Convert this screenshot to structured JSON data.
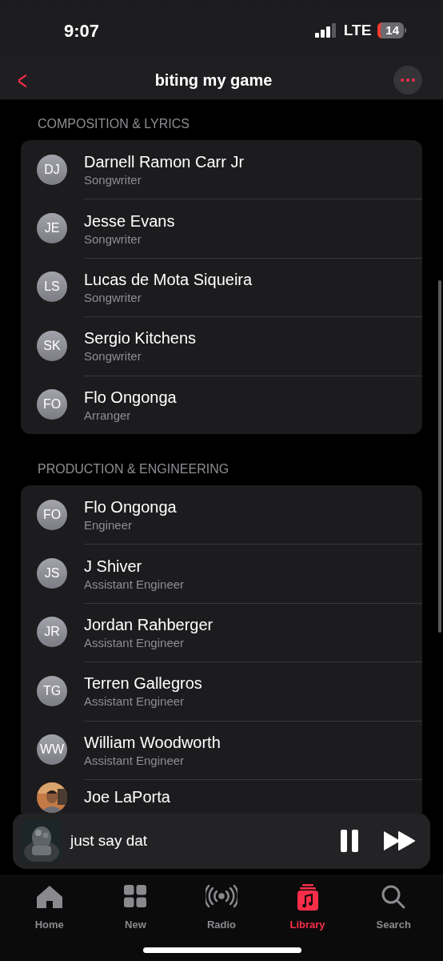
{
  "status_bar": {
    "time": "9:07",
    "network": "LTE",
    "battery": "14"
  },
  "nav": {
    "back": "<",
    "title": "biting my game"
  },
  "sections": [
    {
      "header": "COMPOSITION & LYRICS",
      "people": [
        {
          "kind": "initials",
          "initials": "DJ",
          "name": "Darnell Ramon Carr Jr",
          "role": "Songwriter"
        },
        {
          "kind": "initials",
          "initials": "JE",
          "name": "Jesse Evans",
          "role": "Songwriter"
        },
        {
          "kind": "initials",
          "initials": "LS",
          "name": "Lucas de Mota Siqueira",
          "role": "Songwriter"
        },
        {
          "kind": "initials",
          "initials": "SK",
          "name": "Sergio Kitchens",
          "role": "Songwriter"
        },
        {
          "kind": "initials",
          "initials": "FO",
          "name": "Flo Ongonga",
          "role": "Arranger"
        }
      ]
    },
    {
      "header": "PRODUCTION & ENGINEERING",
      "people": [
        {
          "kind": "initials",
          "initials": "FO",
          "name": "Flo Ongonga",
          "role": "Engineer"
        },
        {
          "kind": "initials",
          "initials": "JS",
          "name": "J Shiver",
          "role": "Assistant Engineer"
        },
        {
          "kind": "initials",
          "initials": "JR",
          "name": "Jordan Rahberger",
          "role": "Assistant Engineer"
        },
        {
          "kind": "initials",
          "initials": "TG",
          "name": "Terren Gallegros",
          "role": "Assistant Engineer"
        },
        {
          "kind": "initials",
          "initials": "WW",
          "name": "William Woodworth",
          "role": "Assistant Engineer"
        },
        {
          "name": "Joe LaPorta"
        }
      ]
    }
  ],
  "mini_player": {
    "title": "just say dat",
    "playing": true
  },
  "tabs": [
    {
      "label": "Home",
      "kind": "home",
      "selected": false
    },
    {
      "label": "New",
      "kind": "grid",
      "selected": false
    },
    {
      "label": "Radio",
      "kind": "radio",
      "selected": false
    },
    {
      "label": "Library",
      "kind": "library",
      "selected": true
    },
    {
      "label": "Search",
      "kind": "search",
      "selected": false
    }
  ]
}
